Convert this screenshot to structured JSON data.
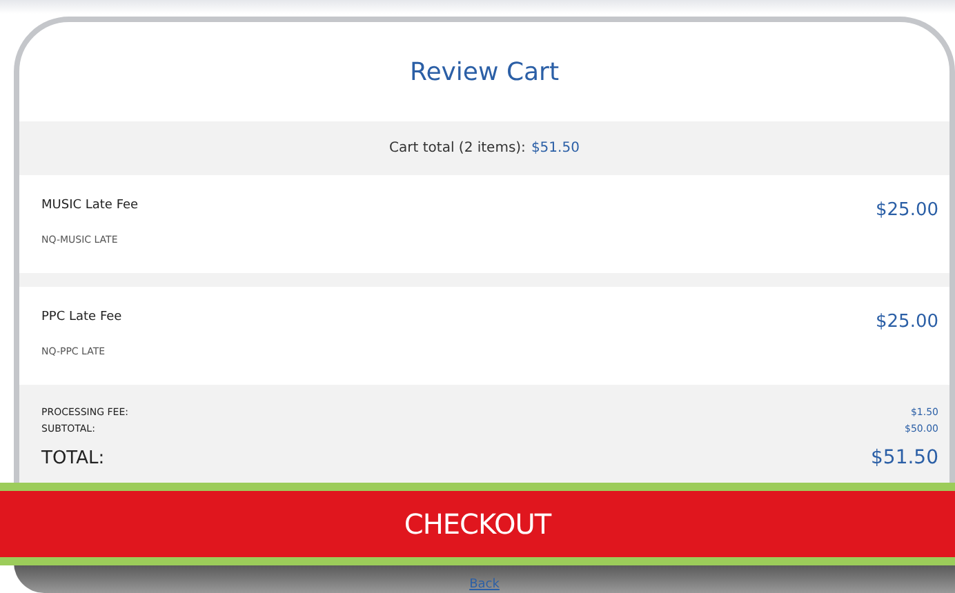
{
  "title": "Review Cart",
  "cart_total": {
    "label": "Cart total (2 items):",
    "amount": "$51.50"
  },
  "items": [
    {
      "name": "MUSIC Late Fee",
      "code": "NQ-MUSIC LATE",
      "price": "$25.00"
    },
    {
      "name": "PPC Late Fee",
      "code": "NQ-PPC LATE",
      "price": "$25.00"
    }
  ],
  "summary": [
    {
      "label": "PROCESSING FEE:",
      "value": "$1.50"
    },
    {
      "label": "SUBTOTAL:",
      "value": "$50.00"
    }
  ],
  "total": {
    "label": "TOTAL:",
    "value": "$51.50"
  },
  "checkout_button": "CHECKOUT",
  "back_link": "Back"
}
